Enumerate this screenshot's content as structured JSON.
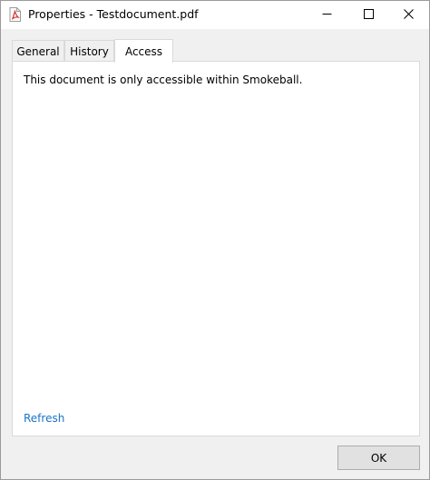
{
  "window": {
    "title": "Properties - Testdocument.pdf",
    "icons": {
      "app": "pdf-file-icon",
      "minimize": "minimize-icon",
      "maximize": "maximize-icon",
      "close": "close-icon"
    }
  },
  "tabs": [
    {
      "label": "General",
      "selected": false
    },
    {
      "label": "History",
      "selected": false
    },
    {
      "label": "Access",
      "selected": true
    }
  ],
  "access_panel": {
    "message": "This document is only accessible within Smokeball.",
    "refresh_label": "Refresh"
  },
  "footer": {
    "ok_label": "OK"
  },
  "colors": {
    "link": "#1a73c9",
    "pdf_icon": "#d8302b"
  }
}
